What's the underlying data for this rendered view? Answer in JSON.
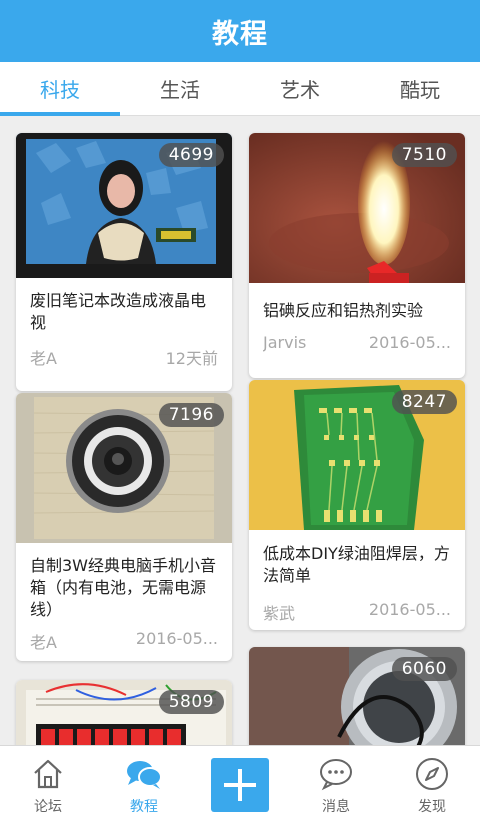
{
  "header": {
    "title": "教程"
  },
  "tabs": [
    {
      "label": "科技",
      "active": true
    },
    {
      "label": "生活",
      "active": false
    },
    {
      "label": "艺术",
      "active": false
    },
    {
      "label": "酷玩",
      "active": false
    }
  ],
  "cards": [
    {
      "views": "4699",
      "title": "废旧笔记本改造成液晶电视",
      "author": "老A",
      "date": "12天前"
    },
    {
      "views": "7510",
      "title": "铝碘反应和铝热剂实验",
      "author": "Jarvis",
      "date": "2016-05..."
    },
    {
      "views": "7196",
      "title": "自制3W经典电脑手机小音箱（内有电池，无需电源线）",
      "author": "老A",
      "date": "2016-05..."
    },
    {
      "views": "8247",
      "title": "低成本DIY绿油阻焊层，方法简单",
      "author": "紫武",
      "date": "2016-05..."
    },
    {
      "views": "5809"
    },
    {
      "views": "6060"
    }
  ],
  "bottom_nav": [
    {
      "label": "论坛",
      "icon": "home-icon",
      "active": false
    },
    {
      "label": "教程",
      "icon": "chat-bubbles-icon",
      "active": true
    },
    {
      "label": "",
      "icon": "plus-icon",
      "active": false
    },
    {
      "label": "消息",
      "icon": "message-icon",
      "active": false
    },
    {
      "label": "发现",
      "icon": "compass-icon",
      "active": false
    }
  ],
  "colors": {
    "accent": "#3aa8ec",
    "background": "#eeeeee",
    "muted_text": "#a8a8a8"
  }
}
